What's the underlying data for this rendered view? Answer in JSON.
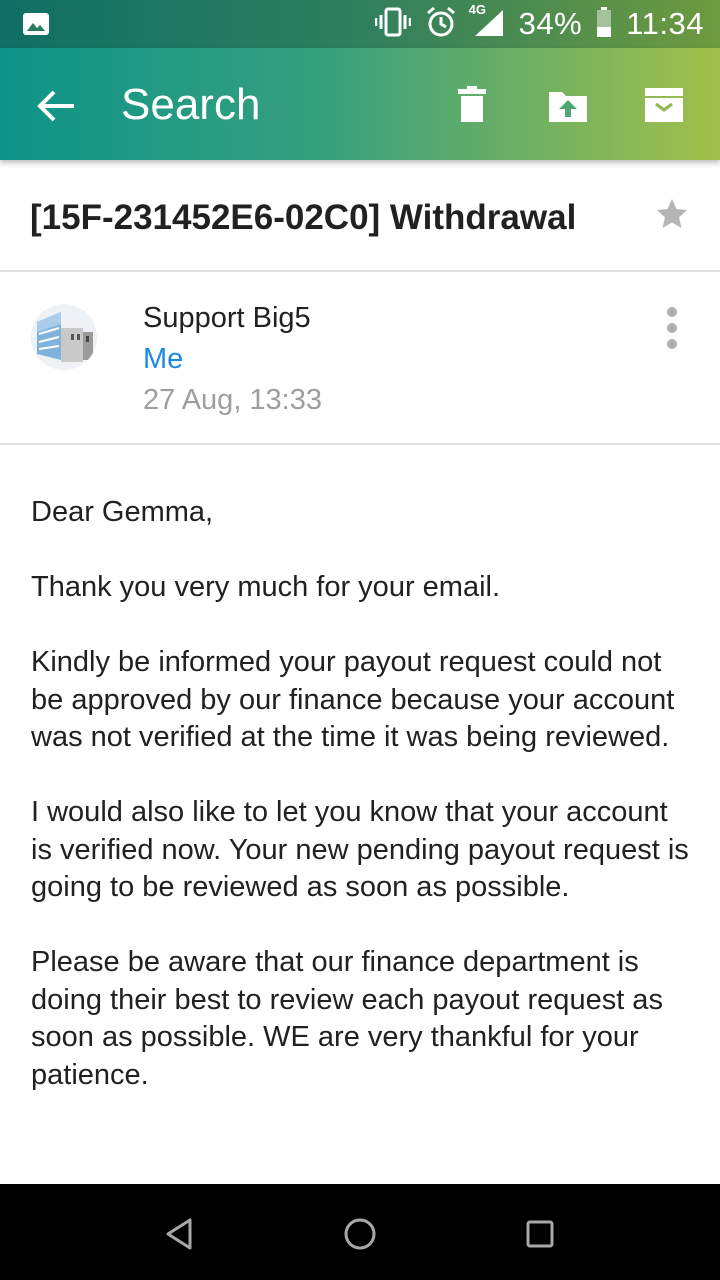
{
  "status_bar": {
    "battery": "34%",
    "time": "11:34",
    "network": "4G",
    "icons": [
      "image-icon",
      "vibrate-icon",
      "alarm-icon",
      "signal-icon",
      "battery-icon"
    ]
  },
  "app_bar": {
    "title": "Search",
    "icons": [
      "back-arrow-icon",
      "delete-icon",
      "move-to-folder-icon",
      "archive-icon"
    ]
  },
  "email": {
    "subject": "[15F-231452E6-02C0]  Withdrawal",
    "sender": "Support Big5",
    "recipient": "Me",
    "date": "27 Aug, 13:33",
    "body": [
      "Dear Gemma,",
      "Thank you very much for your email.",
      "Kindly be informed your payout request could not be approved by our finance because your account was not verified at the time it was being reviewed.",
      "I would also like to let you know that your account is verified now. Your new pending payout request is going to be reviewed as soon as possible.",
      "Please be aware that our finance department is doing their best to review each payout request as soon as possible. WE are very thankful for your patience."
    ]
  },
  "nav_bar": {
    "icons": [
      "back-triangle-icon",
      "home-circle-icon",
      "recents-square-icon"
    ]
  },
  "colors": {
    "accent_link": "#1e88e5",
    "header_gradient_start": "#0d9488",
    "header_gradient_end": "#a3bf4a"
  }
}
